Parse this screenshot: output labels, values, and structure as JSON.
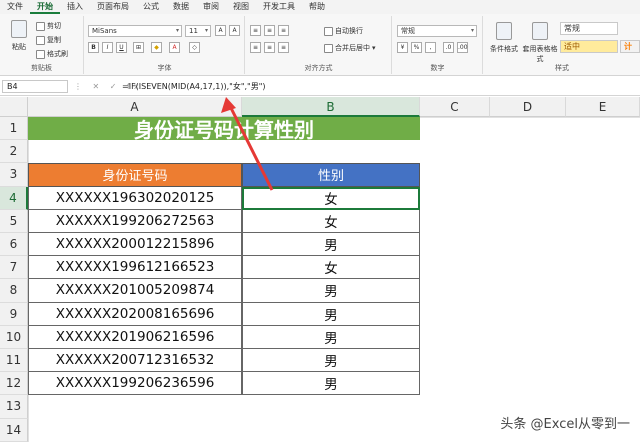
{
  "menu": [
    "文件",
    "开始",
    "插入",
    "页面布局",
    "公式",
    "数据",
    "审阅",
    "视图",
    "开发工具",
    "帮助"
  ],
  "active_menu_index": 1,
  "ribbon": {
    "clipboard": {
      "paste": "粘贴",
      "cut": "剪切",
      "copy": "复制",
      "format_painter": "格式刷",
      "label": "剪贴板"
    },
    "font": {
      "name": "MiSans",
      "size": "11",
      "label": "字体"
    },
    "align": {
      "wrap": "自动换行",
      "merge": "合并后居中",
      "label": "对齐方式"
    },
    "number": {
      "format": "常规",
      "label": "数字"
    },
    "styles": {
      "cond": "条件格式",
      "table": "套用表格格式",
      "normal": "常规",
      "medium": "适中",
      "calc": "计算",
      "label": "样式"
    }
  },
  "formula_bar": {
    "name_box": "B4",
    "icons": "⋮ ✕ ✓ fx",
    "formula": "=IF(ISEVEN(MID(A4,17,1)),\"女\",\"男\")"
  },
  "columns": [
    "A",
    "B",
    "C",
    "D",
    "E"
  ],
  "rows": [
    "1",
    "2",
    "3",
    "4",
    "5",
    "6",
    "7",
    "8",
    "9",
    "10",
    "11",
    "12",
    "13",
    "14"
  ],
  "sheet": {
    "title": "身份证号码计算性别",
    "header_a": "身份证号码",
    "header_b": "性别",
    "records": [
      {
        "id": "XXXXXX196302020125",
        "gender": "女"
      },
      {
        "id": "XXXXXX199206272563",
        "gender": "女"
      },
      {
        "id": "XXXXXX200012215896",
        "gender": "男"
      },
      {
        "id": "XXXXXX199612166523",
        "gender": "女"
      },
      {
        "id": "XXXXXX201005209874",
        "gender": "男"
      },
      {
        "id": "XXXXXX202008165696",
        "gender": "男"
      },
      {
        "id": "XXXXXX201906216596",
        "gender": "男"
      },
      {
        "id": "XXXXXX200712316532",
        "gender": "男"
      },
      {
        "id": "XXXXXX199206236596",
        "gender": "男"
      }
    ]
  },
  "watermark": "头条 @Excel从零到一",
  "colors": {
    "title_bg": "#70ad47",
    "header_a_bg": "#ed7d31",
    "header_b_bg": "#4472c4",
    "arrow": "#e53935",
    "accent": "#1c7a3a"
  }
}
